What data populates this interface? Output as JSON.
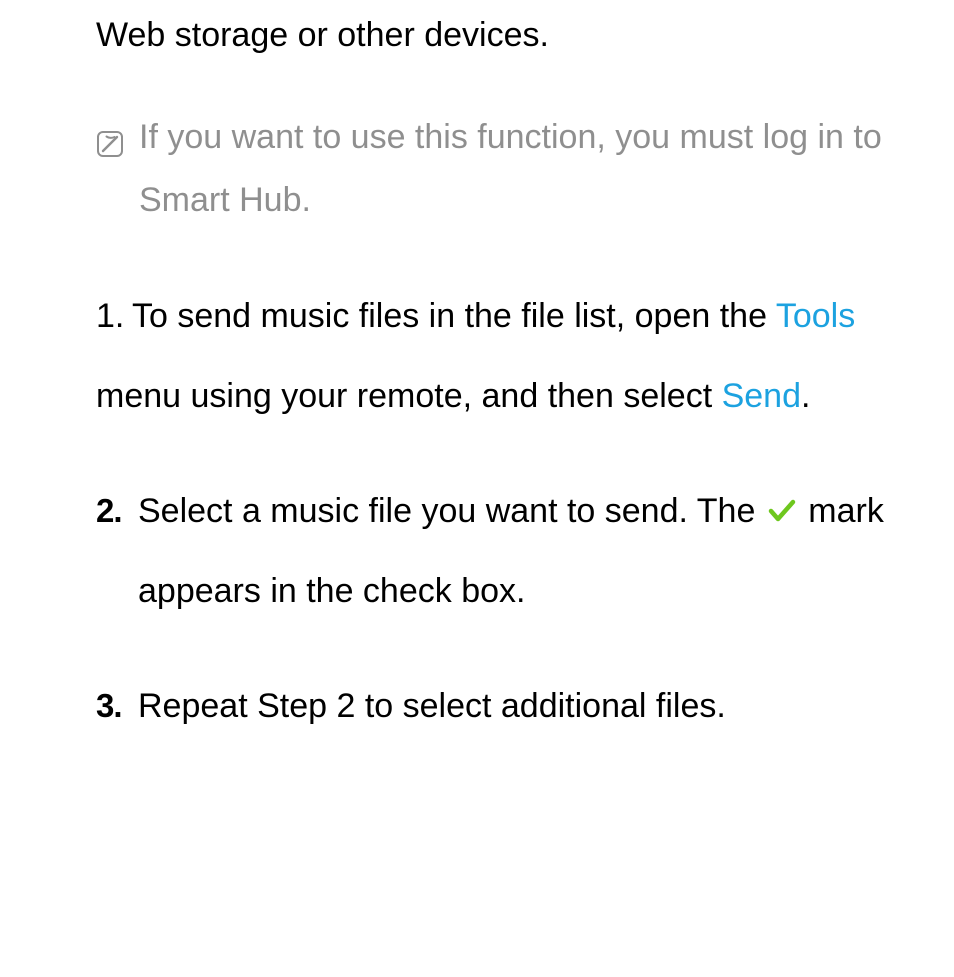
{
  "heading": "Web storage or other devices.",
  "note": {
    "text": "If you want to use this function, you must log in to Smart Hub.",
    "icon": "note-icon"
  },
  "steps": {
    "one": {
      "label": "1.",
      "part1": "To send music files in the file list, open the ",
      "highlight1": "Tools",
      "part2": " menu using your remote, and then select ",
      "highlight2": "Send",
      "part3": "."
    },
    "two": {
      "label": "2.",
      "part1": "Select a music file you want to send. The ",
      "icon": "checkmark-icon",
      "part2": " mark appears in the check box."
    },
    "three": {
      "label": "3.",
      "text": "Repeat Step 2 to select additional files."
    }
  }
}
